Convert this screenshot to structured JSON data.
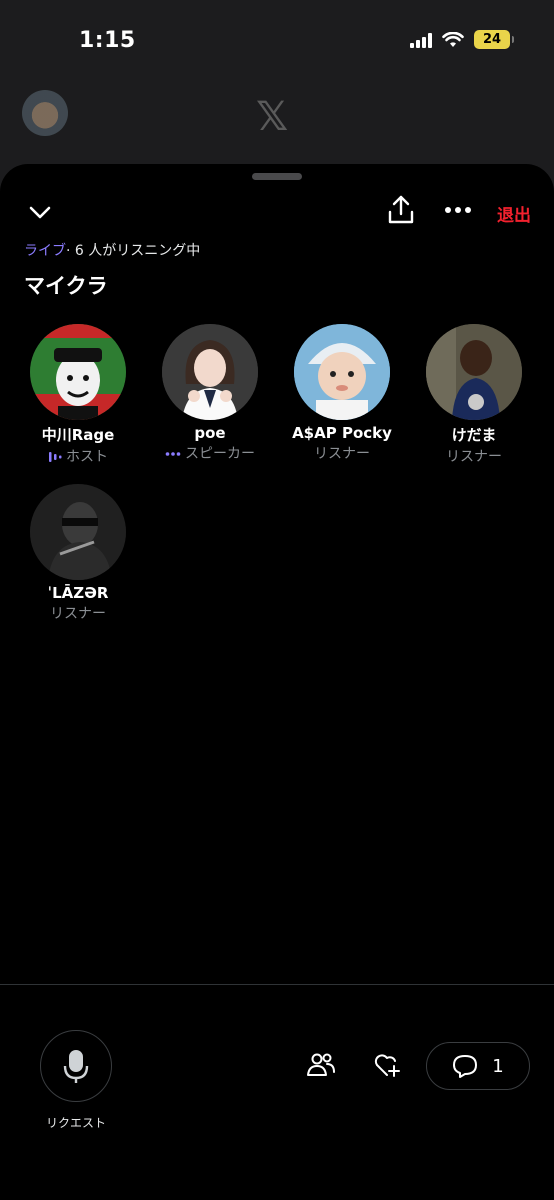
{
  "status_bar": {
    "time": "1:15",
    "battery": "24"
  },
  "background": {
    "logo": "𝕏"
  },
  "sheet": {
    "leave_label": "退出",
    "live_label": "ライブ",
    "listening_text": "· 6 人がリスニング中",
    "title": "マイクラ"
  },
  "participants": [
    {
      "name": "中川Rage",
      "role": "ホスト"
    },
    {
      "name": "poe",
      "role": "スピーカー"
    },
    {
      "name": "A$AP Pocky",
      "role": "リスナー"
    },
    {
      "name": "けだま",
      "role": "リスナー"
    },
    {
      "name": "ˈLĀZƏR",
      "role": "リスナー"
    }
  ],
  "bottom_bar": {
    "request_label": "リクエスト",
    "comment_count": "1"
  },
  "colors": {
    "accent": "#8b7cff",
    "leave": "#f4212e",
    "battery": "#e9d44a"
  }
}
